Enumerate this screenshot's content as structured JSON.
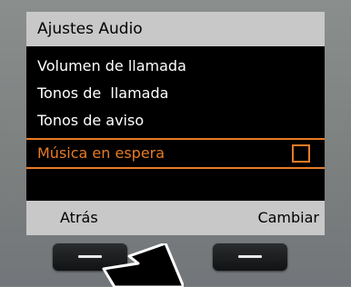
{
  "screen": {
    "title": "Ajustes Audio",
    "menu_items": [
      {
        "label": "Volumen de llamada"
      },
      {
        "label": "Tonos de  llamada"
      },
      {
        "label": "Tonos de aviso"
      },
      {
        "label": "Música en espera",
        "selected": true,
        "checked": false
      }
    ]
  },
  "softkeys": {
    "left_label": "Atrás",
    "right_label": "Cambiar"
  },
  "colors": {
    "highlight": "#e87b25",
    "screen_bg": "#000000",
    "bar_bg": "#c8c8c8"
  },
  "icons": {
    "pointer": "arrow-pointer-icon"
  }
}
